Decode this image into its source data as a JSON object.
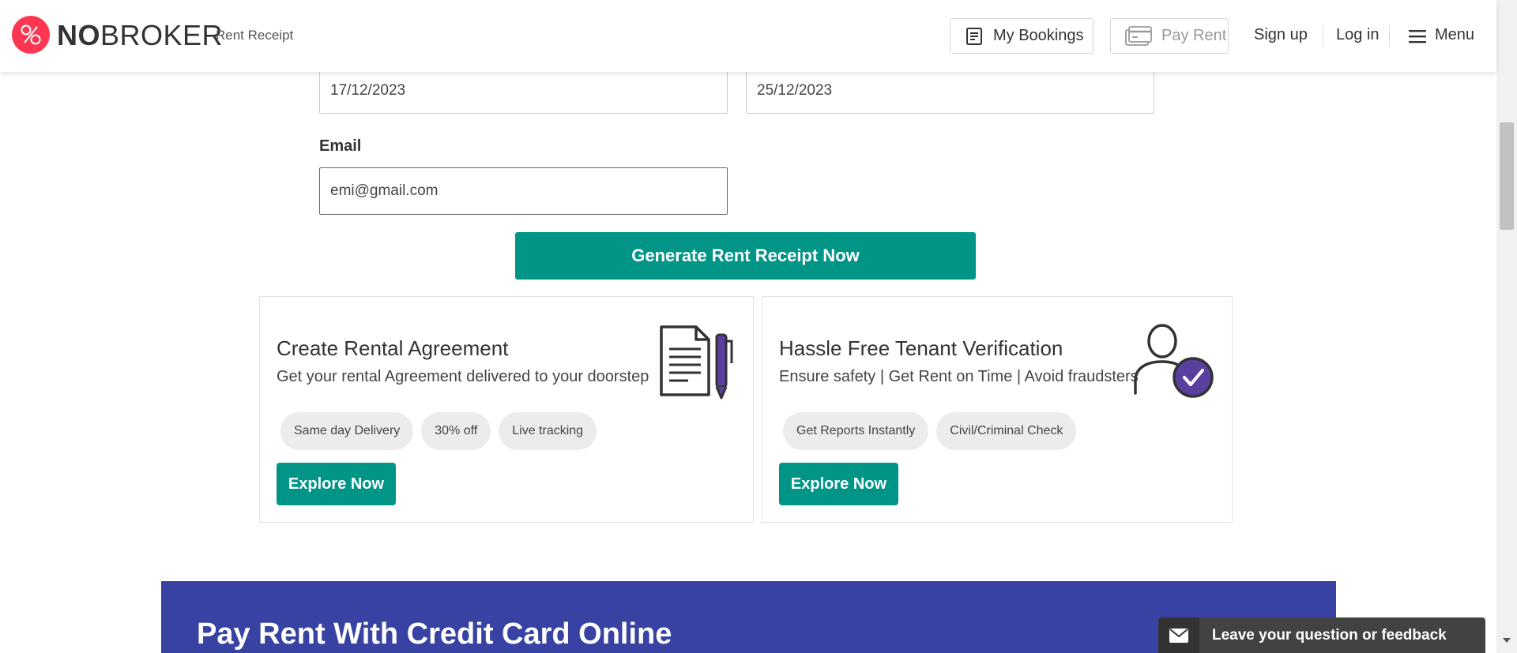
{
  "header": {
    "logo_bold": "NO",
    "logo_thin": "BROKER",
    "logo_subtitle": "Rent Receipt",
    "my_bookings": "My Bookings",
    "pay_rent": "Pay Rent",
    "sign_up": "Sign up",
    "log_in": "Log in",
    "menu": "Menu"
  },
  "form": {
    "date_start": "17/12/2023",
    "date_end": "25/12/2023",
    "email_label": "Email",
    "email_value": "emi@gmail.com",
    "generate_button": "Generate Rent Receipt Now"
  },
  "cards": [
    {
      "title": "Create Rental Agreement",
      "subtitle": "Get your rental Agreement delivered to your doorstep",
      "chips": [
        "Same day Delivery",
        "30% off",
        "Live tracking"
      ],
      "button": "Explore Now",
      "icon": "document-pen-icon"
    },
    {
      "title": "Hassle Free Tenant Verification",
      "subtitle": "Ensure safety | Get Rent on Time | Avoid fraudsters",
      "chips": [
        "Get Reports Instantly",
        "Civil/Criminal Check"
      ],
      "button": "Explore Now",
      "icon": "user-verified-icon"
    }
  ],
  "banner": {
    "title": "Pay Rent With Credit Card Online"
  },
  "feedback": {
    "label": "Leave your question or feedback",
    "icon": "envelope-icon"
  },
  "colors": {
    "brand_red": "#fd3752",
    "teal": "#009587",
    "banner_blue": "#3842a3",
    "accent_purple": "#5a3fa0"
  }
}
